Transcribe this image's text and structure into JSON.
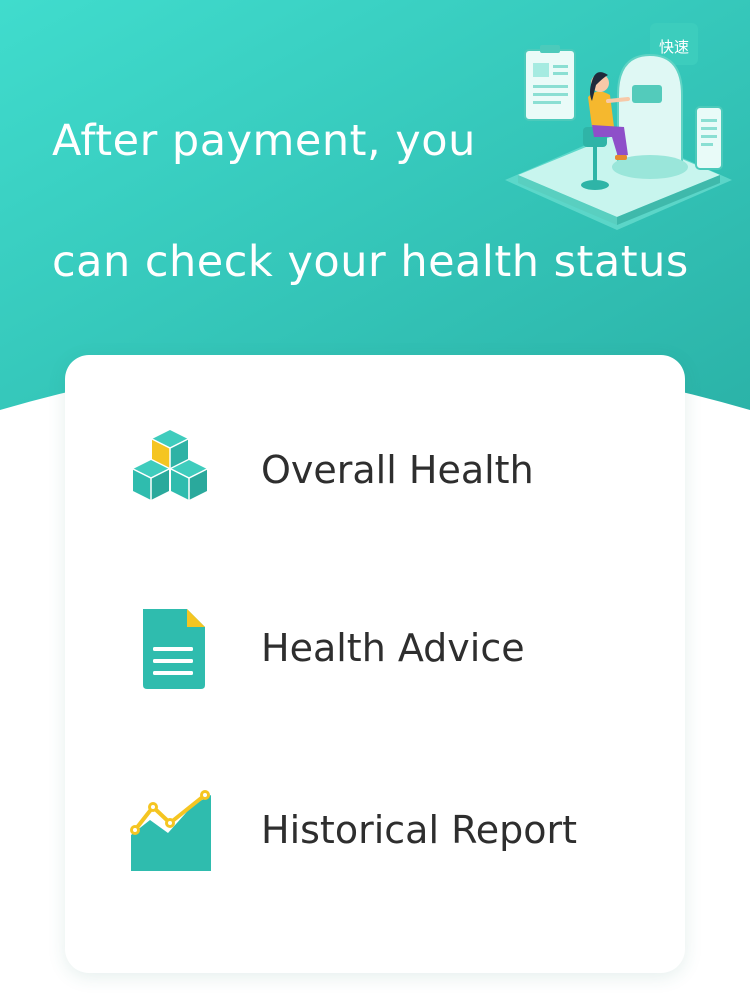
{
  "header": {
    "headline_line1": "After payment, you",
    "headline_line2": "can check your health status",
    "badge_text": "快速"
  },
  "features": [
    {
      "label": "Overall Health",
      "icon": "cubes-icon"
    },
    {
      "label": "Health Advice",
      "icon": "document-icon"
    },
    {
      "label": "Historical Report",
      "icon": "trend-chart-icon"
    }
  ],
  "colors": {
    "teal_light": "#3fd9cb",
    "teal_dark": "#2cb5ab",
    "icon_teal": "#2fbcae",
    "icon_yellow": "#f5c521",
    "text_dark": "#2e2e2e"
  }
}
